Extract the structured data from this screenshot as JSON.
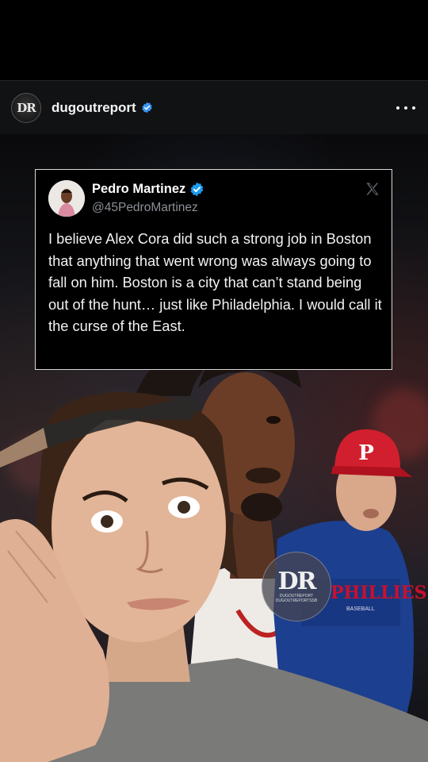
{
  "post": {
    "username": "dugoutreport",
    "avatar_text": "DR",
    "verified_color": "#3897f0"
  },
  "tweet": {
    "name": "Pedro Martinez",
    "handle": "@45PedroMartinez",
    "text": "I believe Alex Cora did such a strong job in Boston that anything that went wrong was always going to fall on him. Boston is a city that can’t stand being out of the hunt… just like Philadelphia.  I would call it the curse of the East.",
    "verified_color": "#1d9bf0"
  },
  "watermark": {
    "logo": "DR",
    "line1": "DUGOUTREPORT",
    "line2": "DUGOUTREPORTSSB"
  },
  "cap": {
    "letter": "P"
  },
  "jersey": {
    "text": "PHILLIES",
    "subtext": "BASEBALL"
  }
}
